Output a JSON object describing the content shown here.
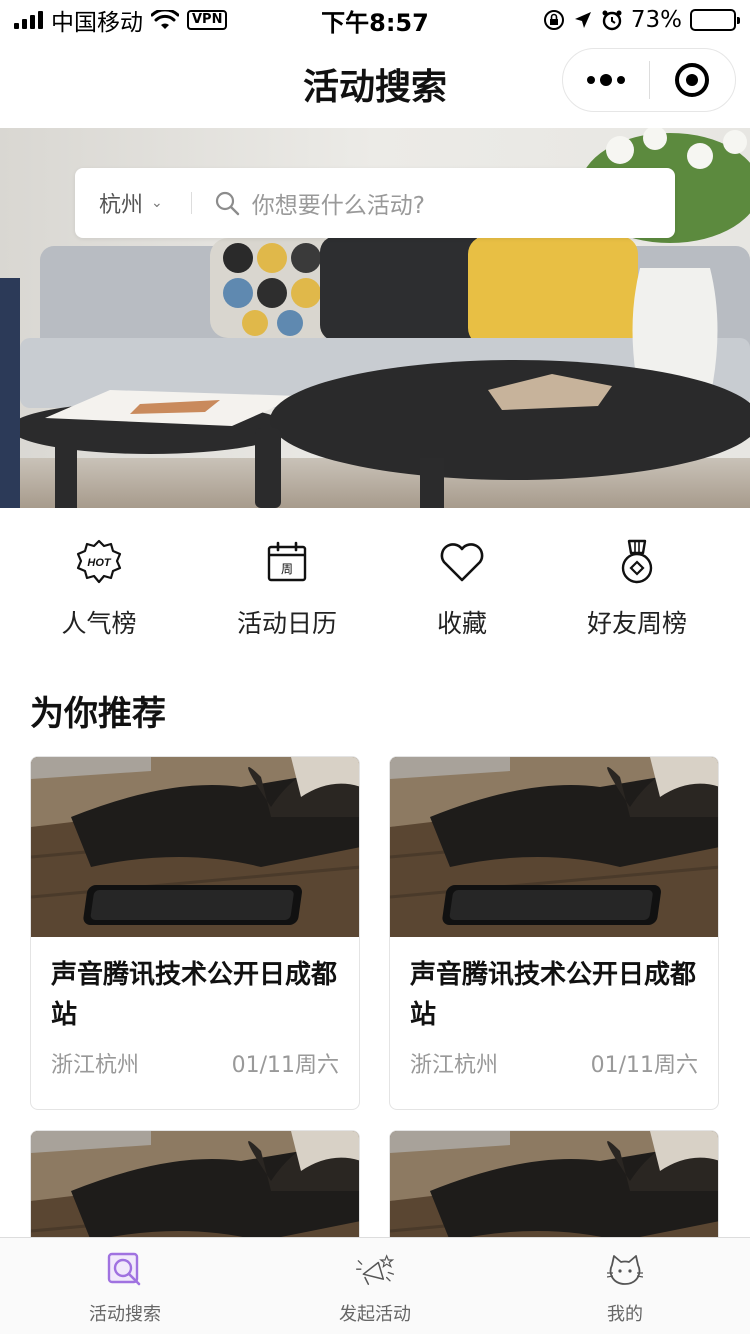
{
  "status_bar": {
    "carrier": "中国移动",
    "vpn": "VPN",
    "time": "下午8:57",
    "battery": "73%",
    "battery_level": 0.73
  },
  "nav": {
    "title": "活动搜索"
  },
  "search": {
    "city": "杭州",
    "placeholder": "你想要什么活动?"
  },
  "quick_entries": [
    {
      "label": "人气榜",
      "icon": "hot-icon"
    },
    {
      "label": "活动日历",
      "icon": "calendar-icon",
      "icon_text": "周"
    },
    {
      "label": "收藏",
      "icon": "heart-icon"
    },
    {
      "label": "好友周榜",
      "icon": "medal-icon"
    }
  ],
  "hot_badge": "HOT",
  "section": {
    "title": "为你推荐"
  },
  "cards": [
    {
      "title": "声音腾讯技术公开日成都站",
      "location": "浙江杭州",
      "date": "01/11周六"
    },
    {
      "title": "声音腾讯技术公开日成都站",
      "location": "浙江杭州",
      "date": "01/11周六"
    },
    {
      "title": "",
      "location": "",
      "date": ""
    },
    {
      "title": "",
      "location": "",
      "date": ""
    }
  ],
  "tabs": [
    {
      "label": "活动搜索",
      "icon": "search-tab-icon",
      "active": true
    },
    {
      "label": "发起活动",
      "icon": "megaphone-icon",
      "active": false
    },
    {
      "label": "我的",
      "icon": "cat-icon",
      "active": false
    }
  ],
  "colors": {
    "accent_purple": "#a072e0",
    "text_primary": "#111111",
    "text_muted": "#999999"
  }
}
